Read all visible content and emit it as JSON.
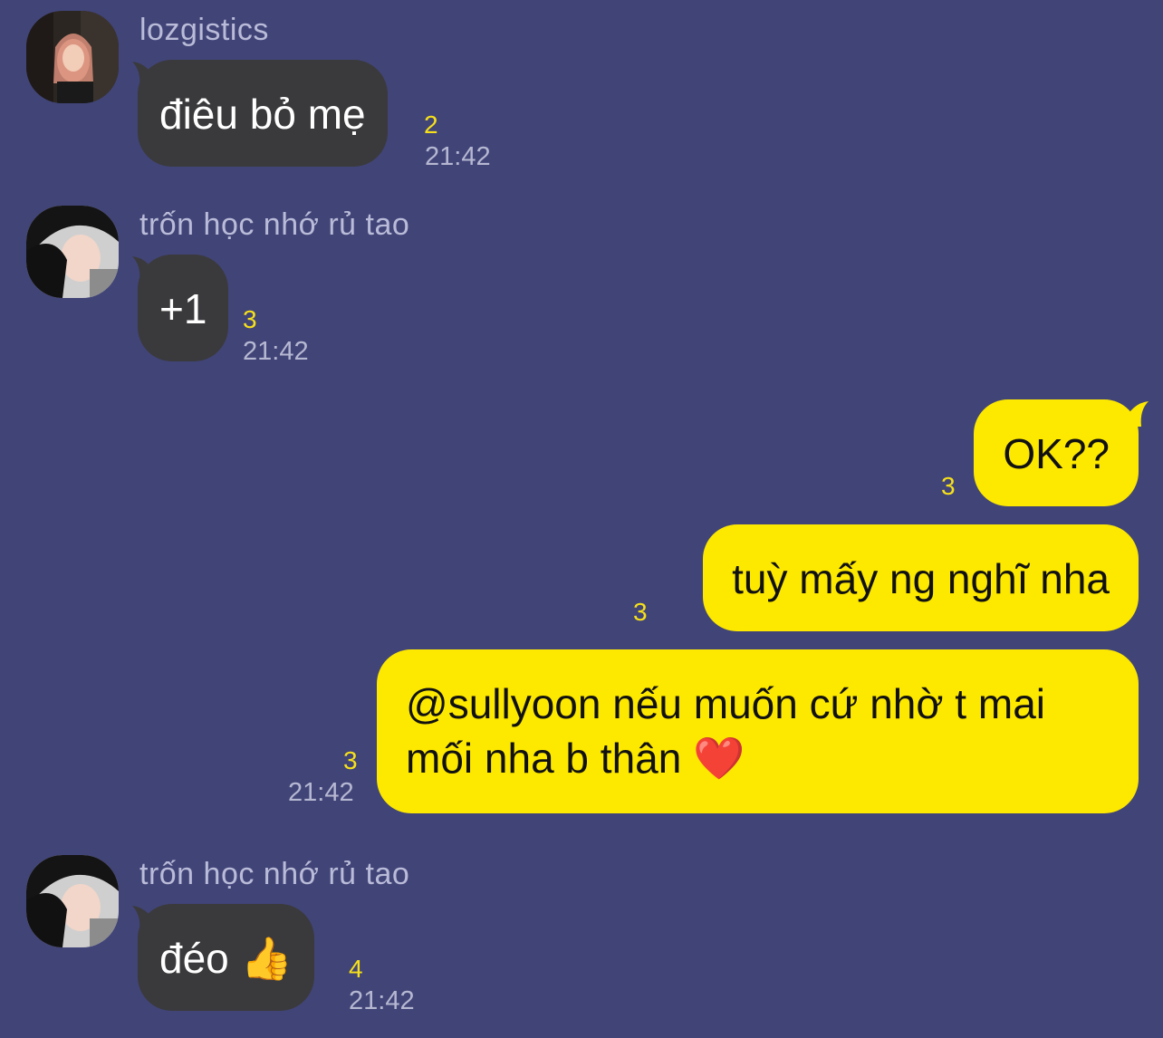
{
  "colors": {
    "background": "#414477",
    "incoming_bubble": "#3a3a3c",
    "outgoing_bubble": "#fde800",
    "unread_count": "#f6e01a",
    "timestamp": "#b6b8d2"
  },
  "messages": [
    {
      "direction": "in",
      "sender": "lozgistics",
      "avatar_icon": "user-avatar-photo",
      "text": "điêu bỏ mẹ",
      "unread": "2",
      "time": "21:42"
    },
    {
      "direction": "in",
      "sender": "trốn học nhớ rủ tao",
      "avatar_icon": "user-avatar-photo",
      "text": "+1",
      "unread": "3",
      "time": "21:42"
    },
    {
      "direction": "out",
      "text": "OK??",
      "unread": "3"
    },
    {
      "direction": "out",
      "text": "tuỳ mấy ng nghĩ nha",
      "unread": "3"
    },
    {
      "direction": "out",
      "text_line1": "@sullyoon nếu muốn cứ nhờ t mai",
      "text_line2": "mối nha b thân ❤️",
      "unread": "3",
      "time": "21:42"
    },
    {
      "direction": "in",
      "sender": "trốn học nhớ rủ tao",
      "avatar_icon": "user-avatar-photo",
      "text": "đéo 👍",
      "unread": "4",
      "time": "21:42"
    }
  ]
}
